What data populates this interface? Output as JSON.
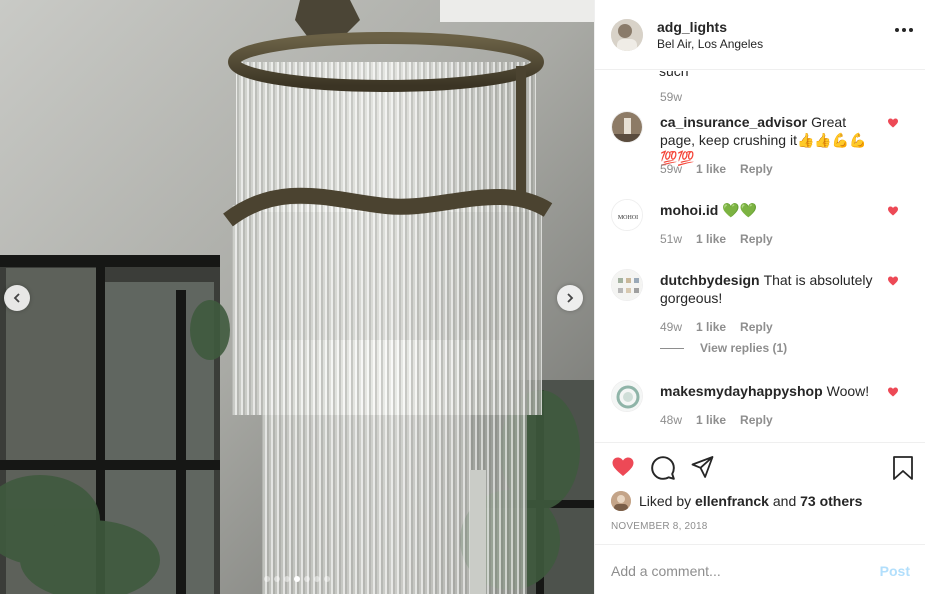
{
  "post": {
    "username": "adg_lights",
    "location": "Bel Air, Los Angeles",
    "carousel": {
      "slides": 7,
      "active_index": 3
    }
  },
  "comments": {
    "truncated_top": {
      "text": "such",
      "time": "59w"
    },
    "items": [
      {
        "username": "ca_insurance_advisor",
        "text": "Great page, keep crushing it👍👍💪💪💯💯",
        "time": "59w",
        "likes": "1 like",
        "reply": "Reply",
        "avatar_color": "#7a6a58"
      },
      {
        "username": "mohoi.id",
        "text": "💚💚",
        "time": "51w",
        "likes": "1 like",
        "reply": "Reply",
        "avatar_text": "MOHOI"
      },
      {
        "username": "dutchbydesign",
        "text": "That is absolutely gorgeous!",
        "time": "49w",
        "likes": "1 like",
        "reply": "Reply",
        "view_replies": "View replies (1)"
      },
      {
        "username": "makesmydayhappyshop",
        "text": "Woow!",
        "time": "48w",
        "likes": "1 like",
        "reply": "Reply"
      }
    ]
  },
  "footer": {
    "liked_by_prefix": "Liked by",
    "liked_by_user": "ellenfranck",
    "liked_by_and": "and",
    "liked_by_others": "73 others",
    "date": "NOVEMBER 8, 2018",
    "comment_placeholder": "Add a comment...",
    "post_label": "Post"
  },
  "colors": {
    "heart_red": "#ed4956",
    "muted_text": "#8e8e8e",
    "post_disabled": "#b2dffc"
  },
  "icons": [
    "chevron-left-icon",
    "chevron-right-icon",
    "more-icon",
    "heart-icon",
    "comment-icon",
    "share-icon",
    "bookmark-icon"
  ]
}
